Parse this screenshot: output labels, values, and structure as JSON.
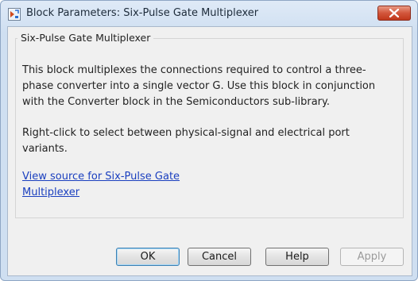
{
  "window": {
    "title": "Block Parameters: Six-Pulse Gate Multiplexer"
  },
  "group": {
    "title": "Six-Pulse Gate Multiplexer",
    "description": "This block multiplexes the connections required to control a three-phase converter into a single vector G. Use this block in conjunction with the Converter block in the Semiconductors sub-library.",
    "note": "Right-click to select between physical-signal and electrical port variants.",
    "link_line1": "View source for Six-Pulse Gate",
    "link_line2": "Multiplexer"
  },
  "buttons": {
    "ok": "OK",
    "cancel": "Cancel",
    "help": "Help",
    "apply": "Apply"
  },
  "icons": {
    "app": "simulink-block-icon",
    "close": "close-icon"
  },
  "colors": {
    "link": "#1a3fbf",
    "close_button": "#c94a2e",
    "titlebar": "#cfdff1"
  }
}
